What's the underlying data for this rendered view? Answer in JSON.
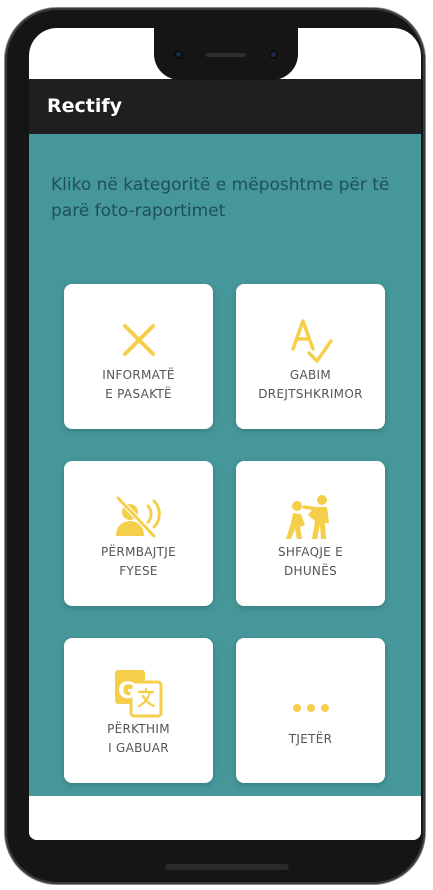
{
  "app": {
    "title": "Rectify"
  },
  "main": {
    "headline": "Kliko në kategoritë e mëposhtme për të parë foto-raportimet"
  },
  "categories": [
    {
      "line1": "INFORMATË",
      "line2": "E PASAKTË",
      "icon": "x-icon"
    },
    {
      "line1": "GABIM",
      "line2": "DREJTSHKRIMOR",
      "icon": "spellcheck-icon"
    },
    {
      "line1": "PËRMBAJTJE",
      "line2": "FYESE",
      "icon": "offensive-speech-icon"
    },
    {
      "line1": "SHFAQJE E",
      "line2": "DHUNËS",
      "icon": "violence-icon"
    },
    {
      "line1": "PËRKTHIM",
      "line2": "I GABUAR",
      "icon": "translate-icon"
    },
    {
      "line1": "TJETËR",
      "line2": "",
      "icon": "more-dots-icon"
    }
  ],
  "colors": {
    "accent": "#f6cf4a",
    "background": "#46979a",
    "headline": "#1e4f5a",
    "appbar": "#1f1f1f"
  }
}
